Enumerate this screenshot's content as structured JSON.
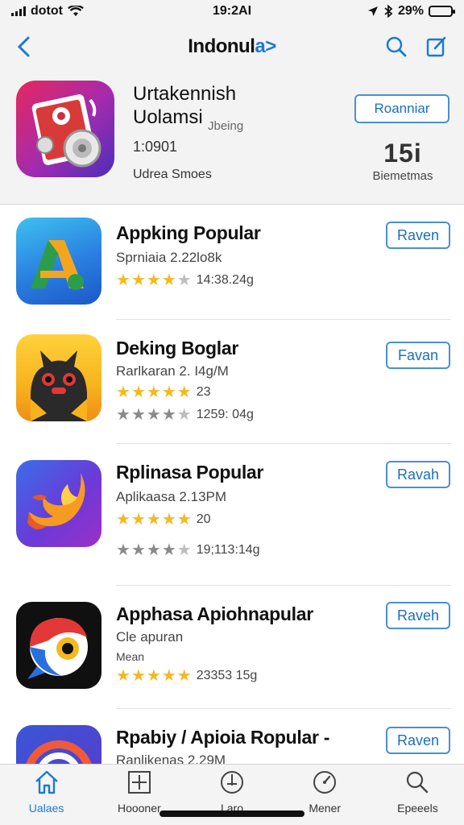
{
  "status_bar": {
    "carrier": "dotot",
    "time": "19:2AI",
    "battery": "29%",
    "battery_level": 0.29
  },
  "nav": {
    "title_main": "Indonul",
    "title_accent": "a>"
  },
  "featured": {
    "title_line1": "Urtakennish",
    "title_line2": "Uolamsi",
    "subtitle": "Jbeing",
    "version": "1:0901",
    "developer": "Udrea Smoes",
    "button_label": "Roanniar",
    "metric_value": "15i",
    "metric_label": "Biemetmas"
  },
  "apps": [
    {
      "name": "Appking Popular",
      "meta": "Sprniaia 2.22lo8k",
      "rating_primary": {
        "stars": 4,
        "text": "14:38.24g"
      },
      "rating_secondary": null,
      "button": "Raven"
    },
    {
      "name": "Deking Boglar",
      "meta": "Rarlkaran 2. I4g/M",
      "rating_primary": {
        "stars": 5,
        "text": "23"
      },
      "rating_secondary": {
        "stars": 4,
        "text": "1259: 04g"
      },
      "button": "Favan"
    },
    {
      "name": "Rplinasa Popular",
      "meta": "Aplikaasa 2.13PM",
      "rating_primary": {
        "stars": 5,
        "text": "20"
      },
      "rating_secondary": {
        "stars": 4,
        "text": "19;113:14g"
      },
      "button": "Ravah"
    },
    {
      "name": "Apphasa Apiohnapular",
      "meta": "Cle apuran",
      "meta2": "Mean",
      "rating_primary": {
        "stars": 5,
        "text": "23353 15g"
      },
      "rating_secondary": null,
      "button": "Raveh"
    },
    {
      "name": "Rpabiy / Apioia Ropular -",
      "meta": "Ranlikenas 2.29M",
      "rating_primary": null,
      "rating_secondary": null,
      "button": "Raven"
    }
  ],
  "tabs": [
    {
      "label": "Ualaes",
      "icon": "home-icon",
      "active": true
    },
    {
      "label": "Hoooner",
      "icon": "grid-icon",
      "active": false
    },
    {
      "label": "Laro",
      "icon": "compass-icon",
      "active": false
    },
    {
      "label": "Mener",
      "icon": "gauge-icon",
      "active": false
    },
    {
      "label": "Epeeels",
      "icon": "search-icon",
      "active": false
    }
  ],
  "colors": {
    "accent": "#1a7ad4",
    "star": "#f5b820",
    "button_border": "#4a90d0"
  }
}
